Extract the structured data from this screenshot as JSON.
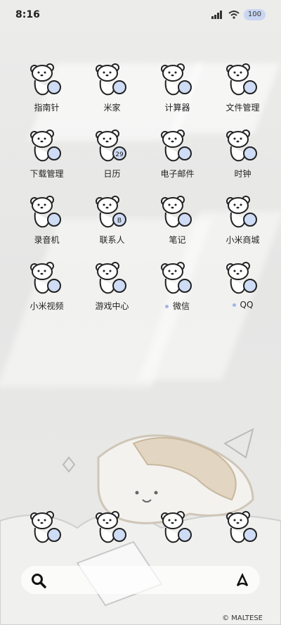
{
  "status": {
    "time": "8:16",
    "battery": "100"
  },
  "apps": [
    {
      "name": "指南针",
      "icon": "compass-app-icon"
    },
    {
      "name": "米家",
      "icon": "mijia-app-icon"
    },
    {
      "name": "计算器",
      "icon": "calculator-app-icon"
    },
    {
      "name": "文件管理",
      "icon": "file-manager-app-icon"
    },
    {
      "name": "下载管理",
      "icon": "downloads-app-icon"
    },
    {
      "name": "日历",
      "icon": "calendar-app-icon",
      "badge": "29"
    },
    {
      "name": "电子邮件",
      "icon": "email-app-icon"
    },
    {
      "name": "时钟",
      "icon": "clock-app-icon"
    },
    {
      "name": "录音机",
      "icon": "recorder-app-icon"
    },
    {
      "name": "联系人",
      "icon": "contacts-app-icon",
      "badge": "B"
    },
    {
      "name": "笔记",
      "icon": "notes-app-icon"
    },
    {
      "name": "小米商城",
      "icon": "mi-store-app-icon"
    },
    {
      "name": "小米视频",
      "icon": "mi-video-app-icon"
    },
    {
      "name": "游戏中心",
      "icon": "game-center-app-icon"
    },
    {
      "name": "微信",
      "icon": "wechat-app-icon"
    },
    {
      "name": "QQ",
      "icon": "qq-app-icon"
    }
  ],
  "dock": [
    "phone-app-icon",
    "messages-app-icon",
    "chat-app-icon",
    "camera-app-icon"
  ],
  "credit": "© MALTESE",
  "colors": {
    "accent": "#9fb6e8",
    "text": "#222222"
  }
}
